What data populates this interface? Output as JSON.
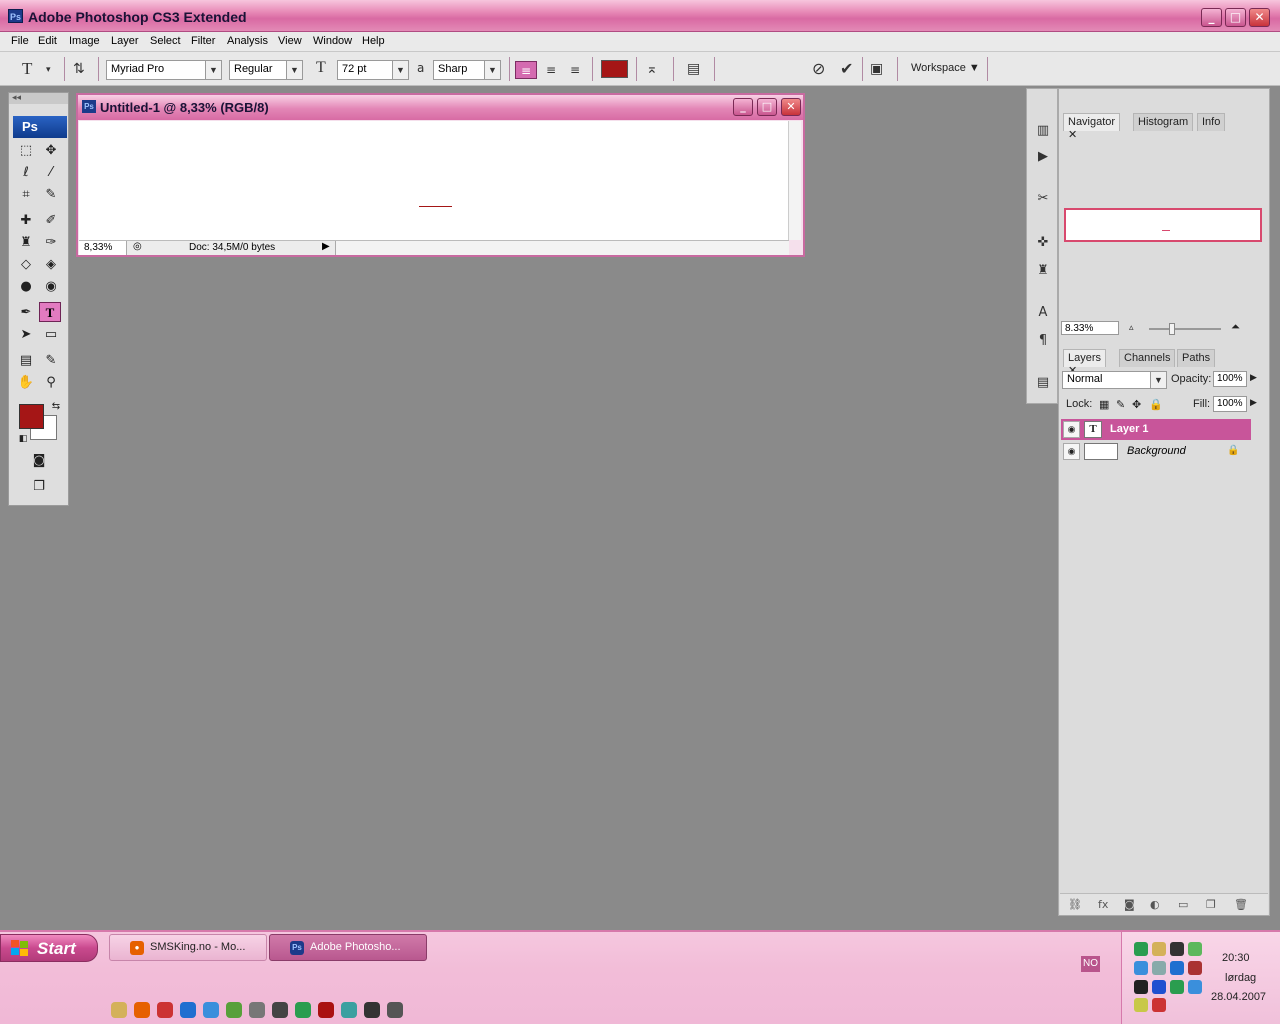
{
  "window": {
    "title": "Adobe Photoshop CS3 Extended",
    "app_badge": "Ps",
    "minimize": "_",
    "maximize": "□",
    "close": "✕"
  },
  "menubar": {
    "items": [
      "File",
      "Edit",
      "Image",
      "Layer",
      "Select",
      "Filter",
      "Analysis",
      "View",
      "Window",
      "Help"
    ]
  },
  "options_bar": {
    "tool_glyph": "T",
    "font_family": "Myriad Pro",
    "font_style": "Regular",
    "font_size": "72 pt",
    "antialias": "Sharp",
    "antialias_glyph": "a",
    "workspace": "Workspace ▼",
    "text_color": "#a51616"
  },
  "toolbox": {
    "logo": "Ps",
    "foreground_color": "#a51616",
    "background_color": "#ffffff"
  },
  "document": {
    "title": "Untitled-1 @ 8,33% (RGB/8)",
    "badge": "Ps",
    "zoom": "8,33%",
    "doc_info": "Doc: 34,5M/0 bytes"
  },
  "navigator": {
    "tabs": [
      "Navigator",
      "Histogram",
      "Info"
    ],
    "zoom": "8.33%"
  },
  "layers": {
    "tabs": [
      "Layers",
      "Channels",
      "Paths"
    ],
    "blend_mode": "Normal",
    "opacity_label": "Opacity:",
    "opacity": "100%",
    "lock_label": "Lock:",
    "fill_label": "Fill:",
    "fill": "100%",
    "items": [
      {
        "name": "Layer 1",
        "thumb": "T"
      },
      {
        "name": "Background"
      }
    ]
  },
  "taskbar": {
    "start": "Start",
    "buttons": [
      {
        "label": "SMSKing.no - Mo...",
        "icon": "firefox-icon"
      },
      {
        "label": "Adobe Photosho...",
        "icon": "photoshop-icon"
      }
    ],
    "language": "NO",
    "time": "20:30",
    "day": "lørdag",
    "date": "28.04.2007"
  },
  "colors": {
    "accent": "#d46bb0",
    "titlebar": "#d96aa3",
    "workspace_bg": "#8a8a8a"
  }
}
